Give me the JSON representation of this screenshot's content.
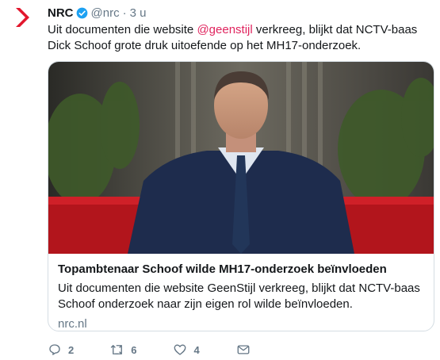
{
  "tweet": {
    "author_name": "NRC",
    "handle": "@nrc",
    "separator": "·",
    "time": "3 u",
    "text_before": "Uit documenten die website ",
    "mention": "@geenstijl",
    "text_after": " verkreeg, blijkt dat NCTV-baas Dick Schoof grote druk uitoefende op het MH17-onderzoek."
  },
  "card": {
    "title": "Topambtenaar Schoof wilde MH17-onderzoek beïnvloeden",
    "description": "Uit documenten die website GeenStijl verkreeg, blijkt dat NCTV-baas Schoof onderzoek naar zijn eigen rol wilde beïnvloeden.",
    "domain": "nrc.nl"
  },
  "actions": {
    "reply_count": "2",
    "retweet_count": "6",
    "like_count": "4"
  },
  "colors": {
    "brand": "#e0245e",
    "verified": "#1da1f2",
    "muted": "#657786"
  }
}
